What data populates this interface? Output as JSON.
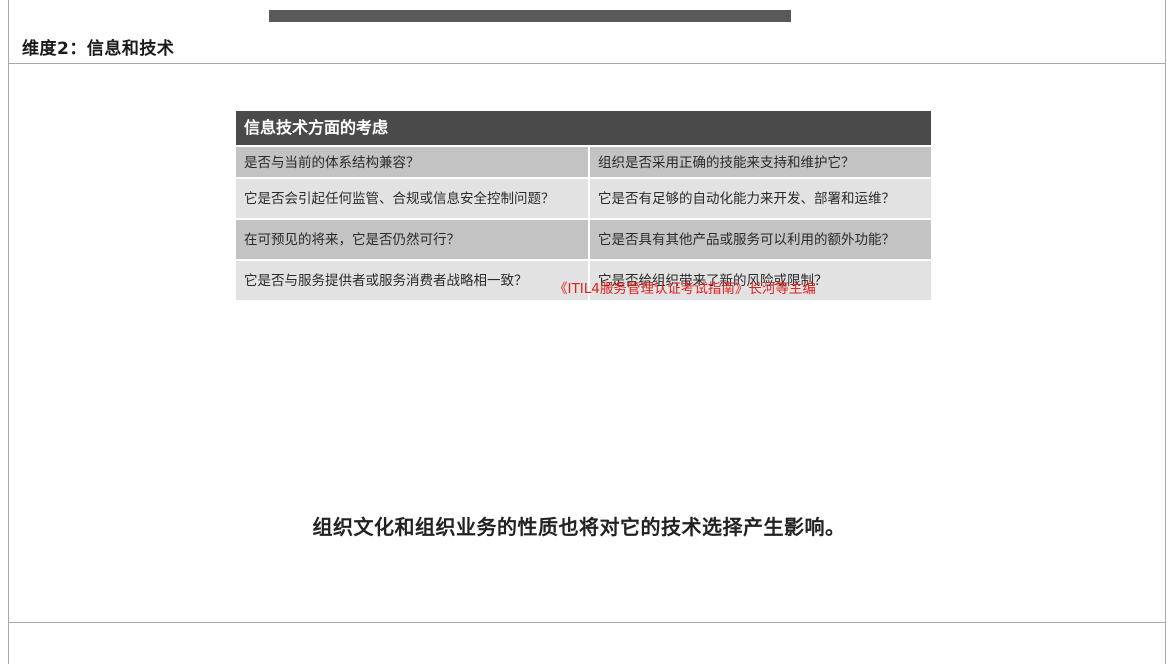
{
  "slide": {
    "title": "维度2：信息和技术",
    "conclusion": "组织文化和组织业务的性质也将对它的技术选择产生影响。"
  },
  "table": {
    "header": "信息技术方面的考虑",
    "rows": [
      [
        "是否与当前的体系结构兼容？",
        "组织是否采用正确的技能来支持和维护它？"
      ],
      [
        "它是否会引起任何监管、合规或信息安全控制问题？",
        "它是否有足够的自动化能力来开发、部署和运维？"
      ],
      [
        "在可预见的将来，它是否仍然可行？",
        "它是否具有其他产品或服务可以利用的额外功能？"
      ],
      [
        "它是否与服务提供者或服务消费者战略相一致？",
        "它是否给组织带来了新的风险或限制？"
      ]
    ],
    "source_note": "《ITIL4服务管理认证考试指南》长河等主编"
  },
  "colors": {
    "header_bg": "#4a4a4a",
    "row_dark": "#c3c3c3",
    "row_light": "#e2e2e2",
    "source_note": "#e02020",
    "top_bar": "#595959"
  }
}
